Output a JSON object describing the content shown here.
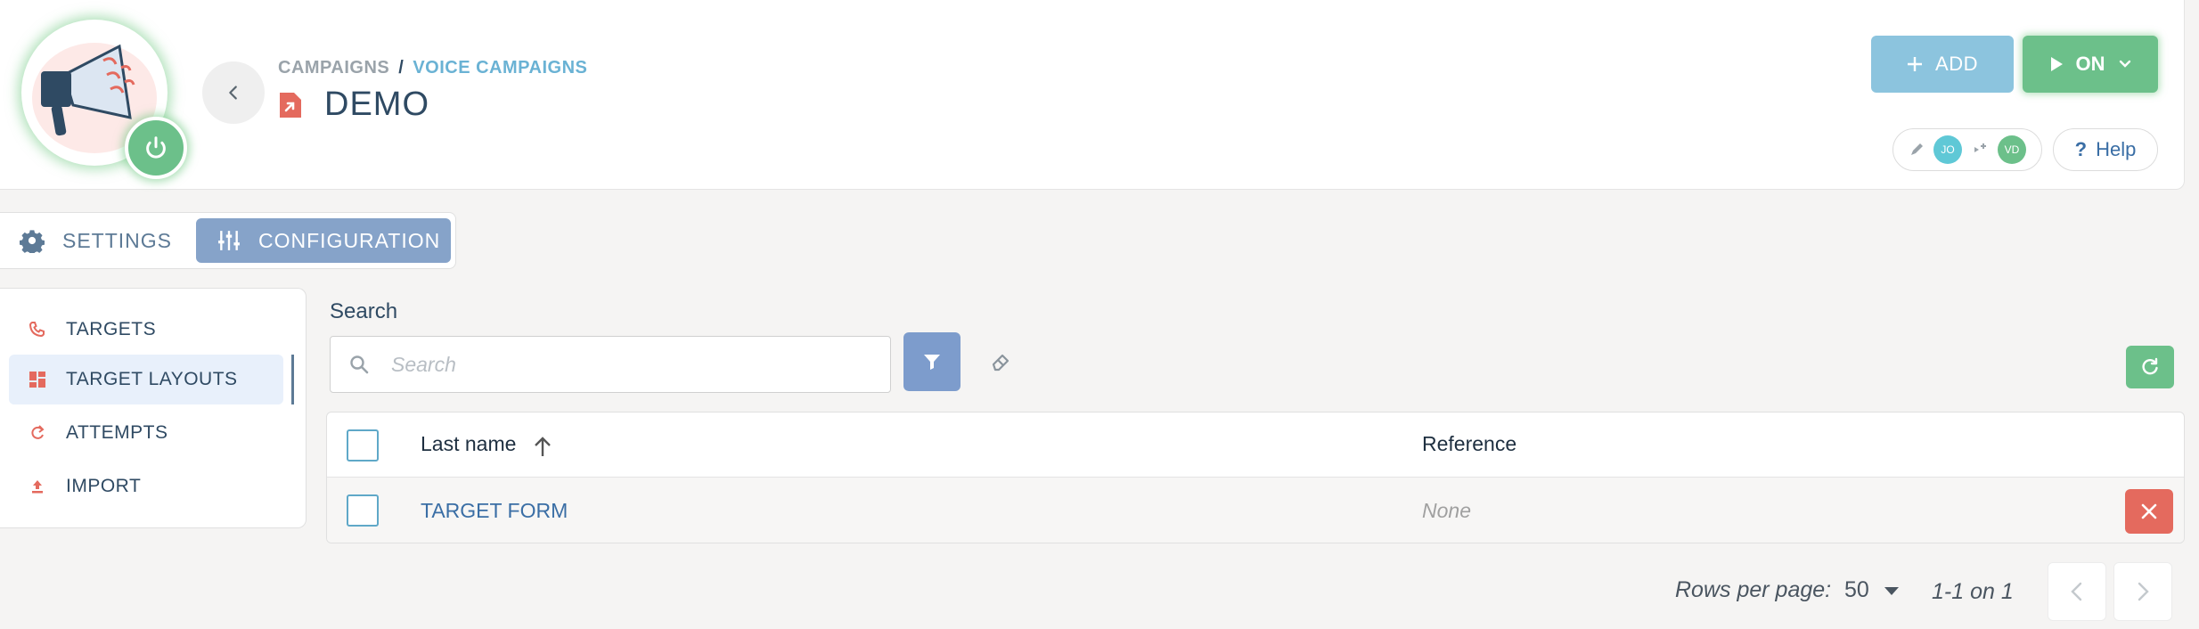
{
  "header": {
    "breadcrumb": {
      "root": "CAMPAIGNS",
      "separator": "/",
      "current": "VOICE CAMPAIGNS"
    },
    "title": "DEMO",
    "add_label": "ADD",
    "status_label": "ON",
    "collaborators": [
      {
        "initials": "JO",
        "color": "#5fc8d6"
      },
      {
        "initials": "VD",
        "color": "#6cc08a"
      }
    ],
    "help_label": "Help"
  },
  "tabs": [
    {
      "label": "SETTINGS",
      "icon": "gear-icon",
      "active": false
    },
    {
      "label": "CONFIGURATION",
      "icon": "sliders-icon",
      "active": true
    }
  ],
  "sidebar": {
    "items": [
      {
        "label": "TARGETS",
        "icon": "phone-icon",
        "active": false
      },
      {
        "label": "TARGET LAYOUTS",
        "icon": "layout-icon",
        "active": true
      },
      {
        "label": "ATTEMPTS",
        "icon": "retry-icon",
        "active": false
      },
      {
        "label": "IMPORT",
        "icon": "upload-icon",
        "active": false
      }
    ]
  },
  "search": {
    "label": "Search",
    "placeholder": "Search",
    "value": ""
  },
  "table": {
    "columns": [
      "Last name",
      "Reference"
    ],
    "sort_column": "Last name",
    "sort_direction": "ascending",
    "rows": [
      {
        "last_name": "TARGET FORM",
        "reference": "None"
      }
    ]
  },
  "pagination": {
    "rows_per_page_label": "Rows per page:",
    "rows_per_page": "50",
    "range": "1-1 on 1"
  },
  "colors": {
    "accent_green": "#6cc08a",
    "accent_blue": "#86a3c9",
    "danger_red": "#e46a5e",
    "link_blue": "#3a6ea5"
  }
}
